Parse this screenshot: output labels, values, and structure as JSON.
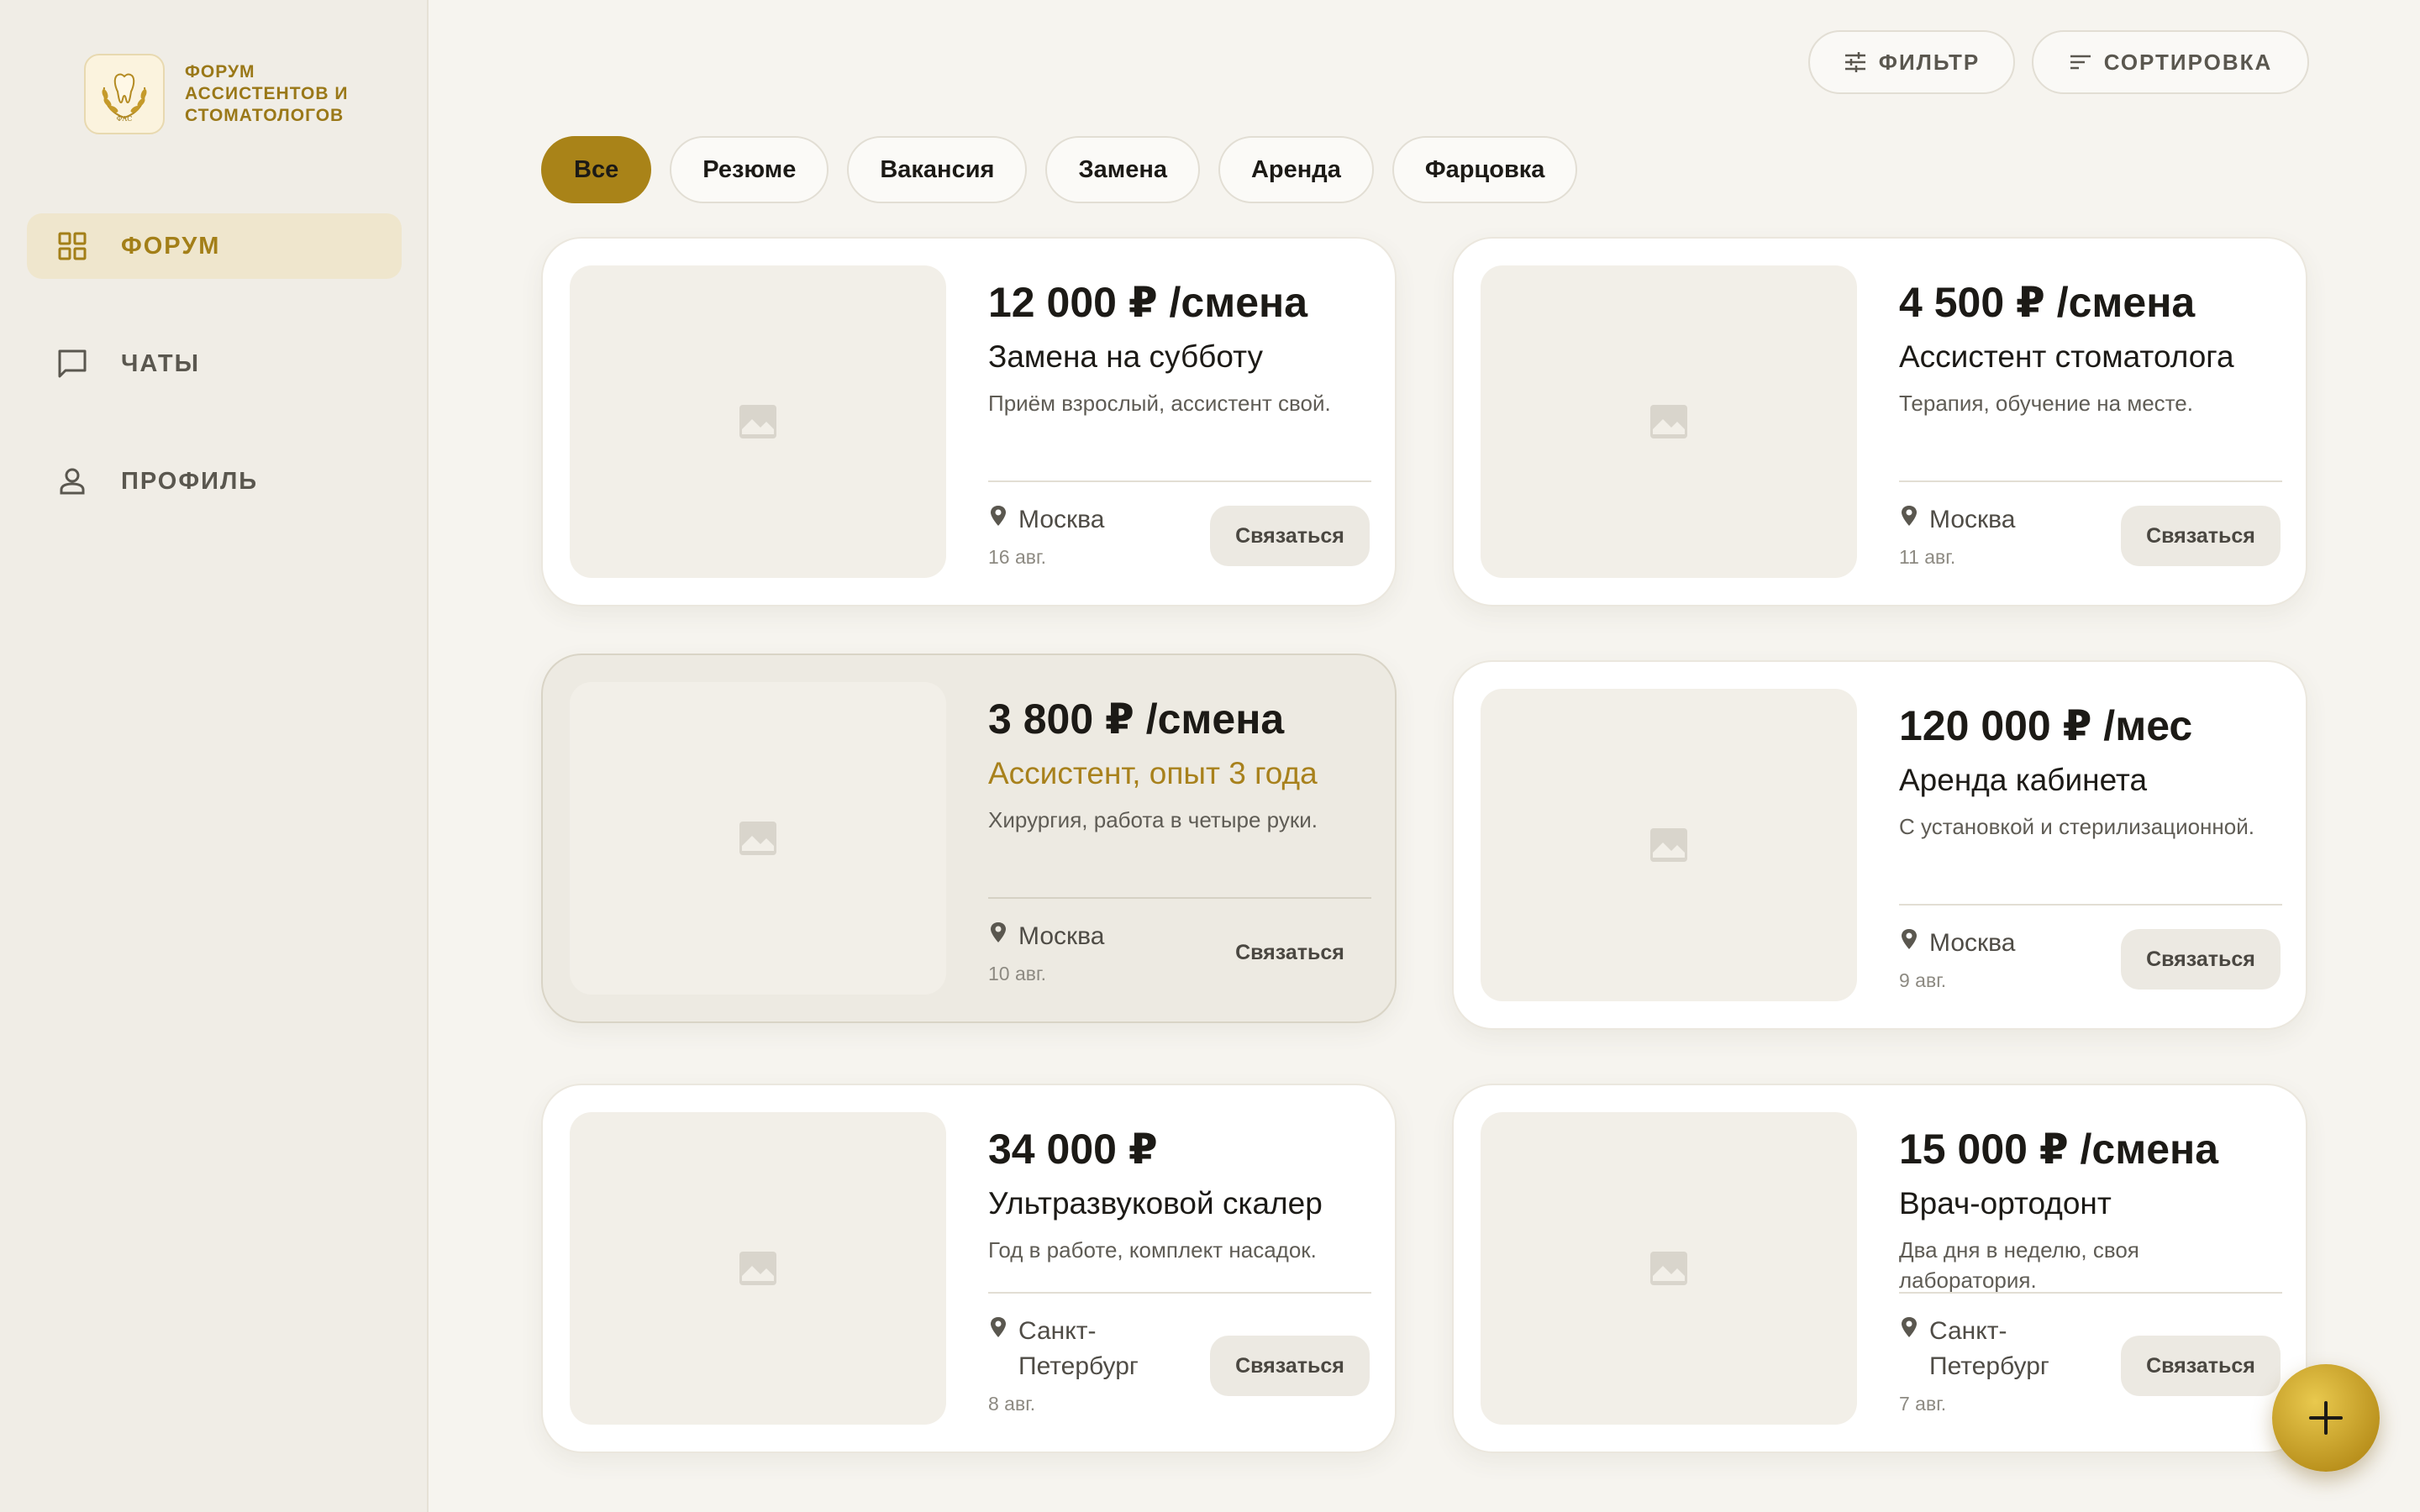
{
  "sidebar": {
    "logo_lines": [
      "ФОРУМ",
      "АССИСТЕНТОВ И",
      "СТОМАТОЛОГОВ"
    ],
    "logo_mark_text": "ФАС",
    "nav": [
      {
        "label": "ФОРУМ",
        "icon": "grid-icon",
        "active": true
      },
      {
        "label": "ЧАТЫ",
        "icon": "chat-icon",
        "active": false
      },
      {
        "label": "ПРОФИЛЬ",
        "icon": "user-icon",
        "active": false
      }
    ]
  },
  "toolbar": {
    "filter_label": "ФИЛЬТР",
    "sort_label": "СОРТИРОВКА"
  },
  "chips": [
    "Все",
    "Резюме",
    "Вакансия",
    "Замена",
    "Аренда",
    "Фарцовка"
  ],
  "active_chip": "Все",
  "accent_color": "#a98318",
  "cards": [
    {
      "price": "12 000 ₽ /смена",
      "title": "Замена на субботу",
      "desc": "Приём взрослый, ассистент свой.",
      "city": "Москва",
      "date": "16 авг.",
      "contact": "Связаться"
    },
    {
      "price": "4 500 ₽ /смена",
      "title": "Ассистент стоматолога",
      "desc": "Терапия, обучение на месте.",
      "city": "Москва",
      "date": "11 авг.",
      "contact": "Связаться"
    },
    {
      "price": "3 800 ₽ /смена",
      "title": "Ассистент, опыт 3 года",
      "desc": "Хирургия, работа в четыре руки.",
      "city": "Москва",
      "date": "10 авг.",
      "contact": "Связаться"
    },
    {
      "price": "120 000 ₽ /мес",
      "title": "Аренда кабинета",
      "desc": "С установкой и стерилизационной.",
      "city": "Москва",
      "date": "9 авг.",
      "contact": "Связаться"
    },
    {
      "price": "34 000 ₽",
      "title": "Ультразвуковой скалер",
      "desc": "Год в работе, комплект насадок.",
      "city": "Санкт-Петербург",
      "date": "8 авг.",
      "contact": "Связаться"
    },
    {
      "price": "15 000 ₽ /смена",
      "title": "Врач-ортодонт",
      "desc": "Два дня в неделю, своя лаборатория.",
      "city": "Санкт-Петербург",
      "date": "7 авг.",
      "contact": "Связаться"
    }
  ],
  "fab_icon": "plus-icon"
}
